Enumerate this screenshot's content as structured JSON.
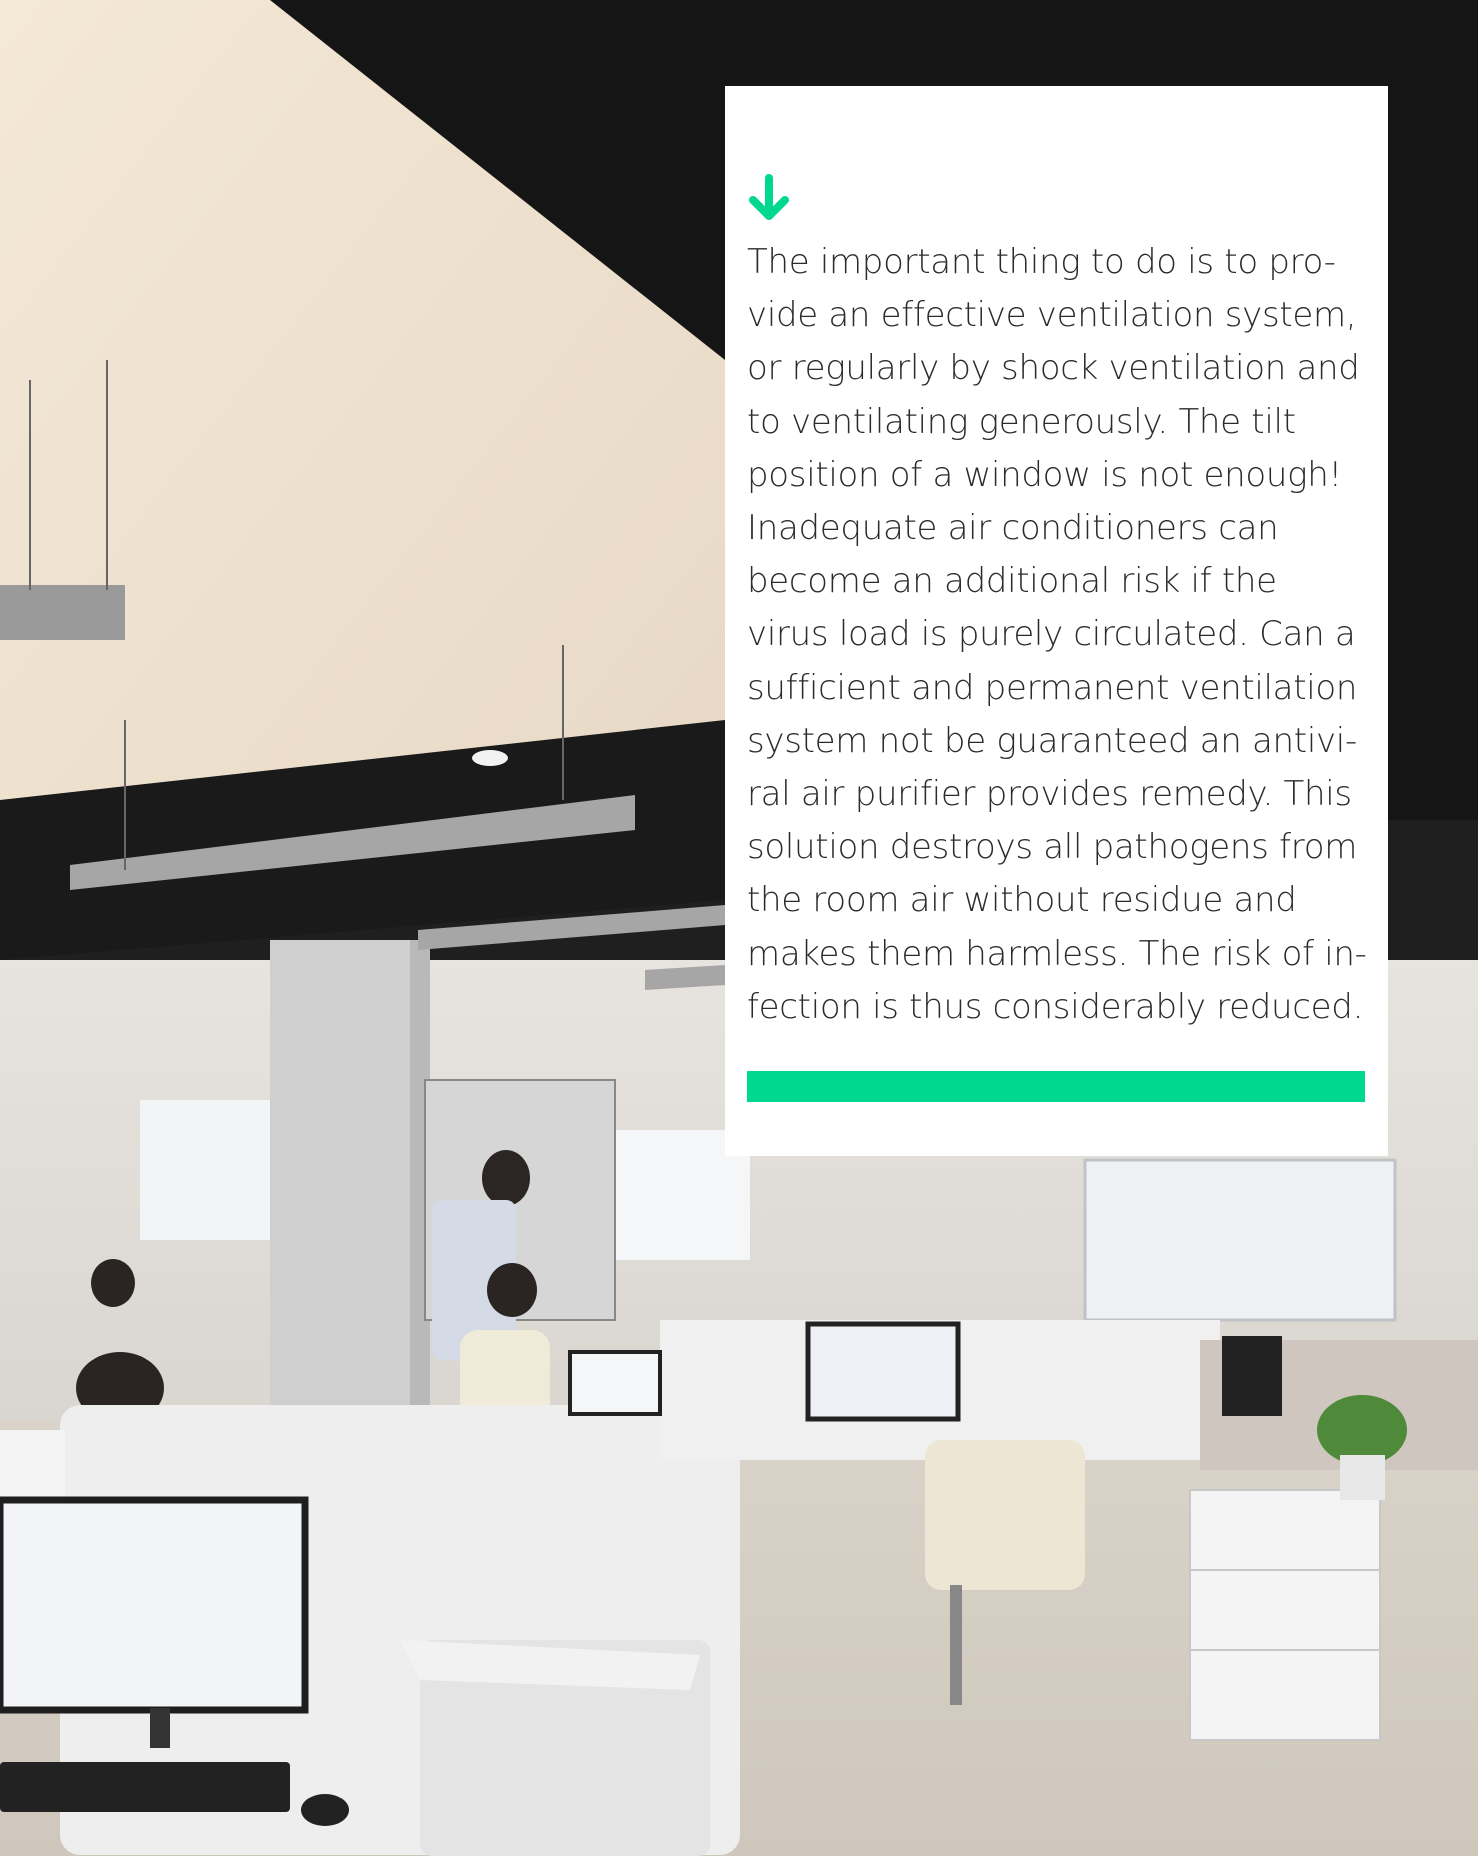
{
  "colors": {
    "accent": "#00d890",
    "card_background": "#ffffff",
    "text": "#2b2b2b"
  },
  "icons": {
    "arrow": "arrow-down-icon"
  },
  "photo": {
    "subject": "office-photo"
  },
  "card": {
    "lines": [
      "The important thing to do is to pro-",
      "vide an effective ventilation system,",
      "or regularly by shock ventilation and",
      "to ventilating generously. The tilt",
      "position of a window is not enough!",
      "Inadequate air conditioners can",
      "become an additional risk if the",
      "virus load is purely circulated. Can a",
      "sufficient and permanent ventilation",
      "system not be guaranteed an antivi-",
      "ral air purifier provides remedy. This",
      "solution destroys all pathogens from",
      "the room air without residue and",
      "makes them harmless. The risk of in-",
      "fection is thus considerably reduced."
    ]
  }
}
